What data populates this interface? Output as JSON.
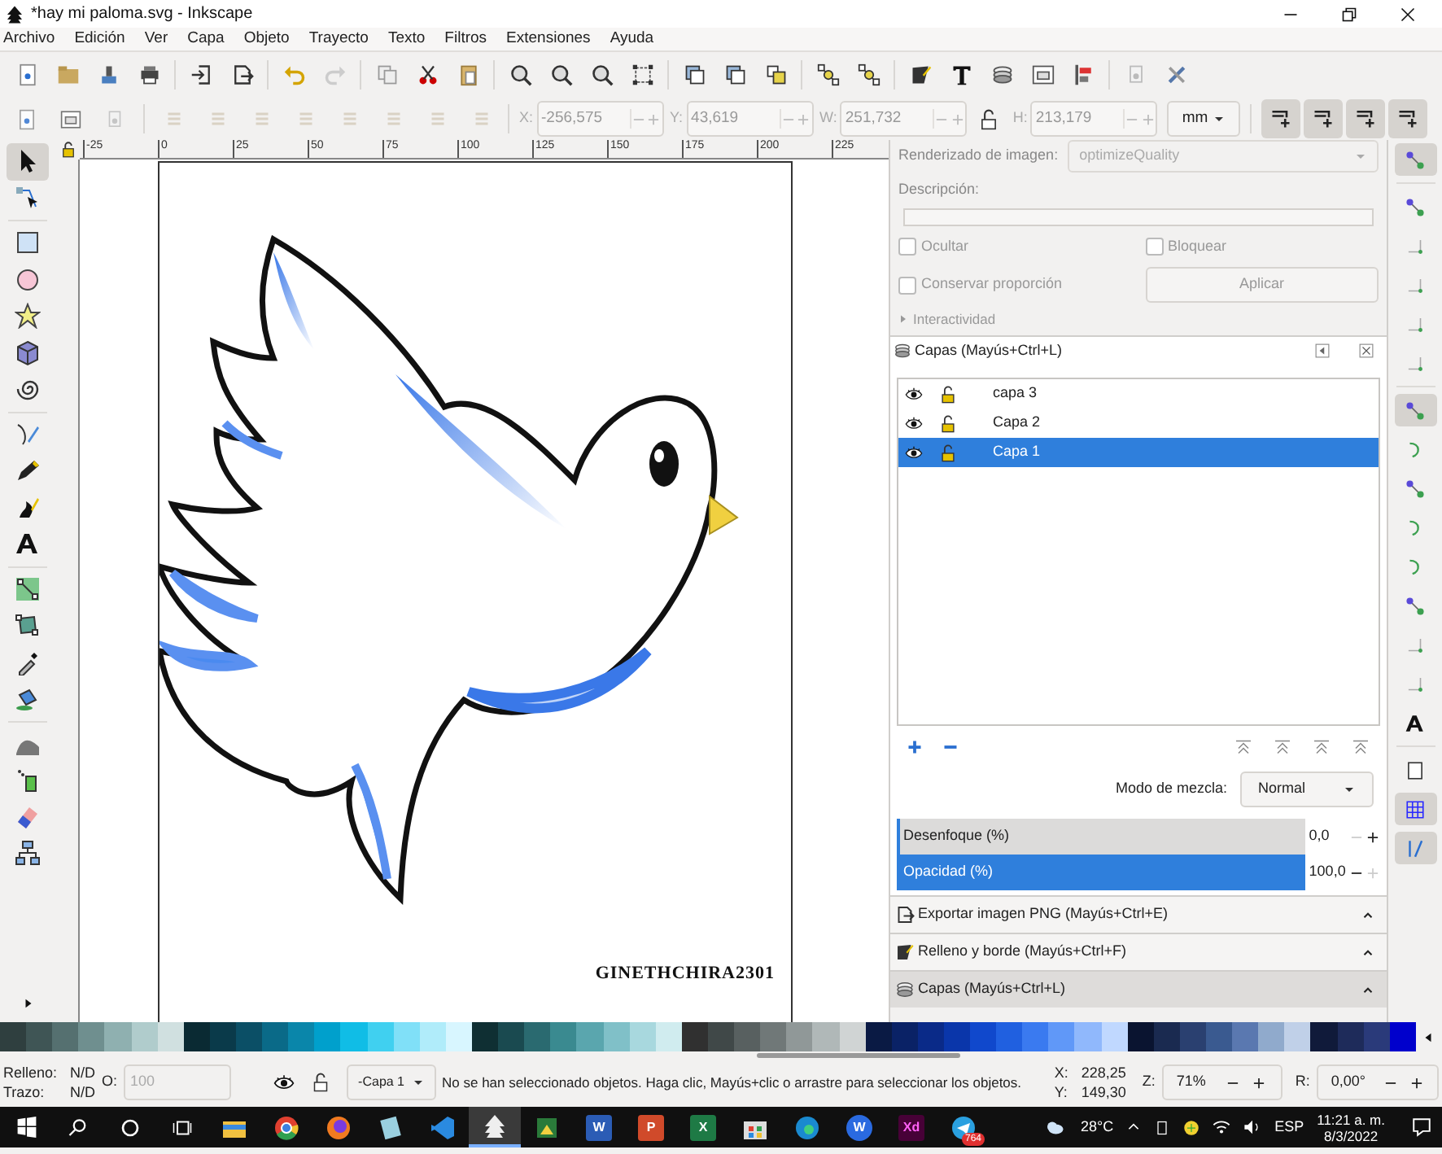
{
  "window": {
    "title": "*hay mi paloma.svg - Inkscape"
  },
  "menu": [
    "Archivo",
    "Edición",
    "Ver",
    "Capa",
    "Objeto",
    "Trayecto",
    "Texto",
    "Filtros",
    "Extensiones",
    "Ayuda"
  ],
  "geometry": [
    {
      "label": "X:",
      "value": "-256,575",
      "disabled": true
    },
    {
      "label": "Y:",
      "value": "43,619",
      "disabled": true
    },
    {
      "label": "W:",
      "value": "251,732",
      "disabled": true
    },
    {
      "label": "H:",
      "value": "213,179",
      "disabled": true
    }
  ],
  "unit": "mm",
  "ruler_labels": [
    "-25",
    "0",
    "25",
    "50",
    "75",
    "100",
    "125",
    "150",
    "175",
    "200",
    "225"
  ],
  "canvas": {
    "signature": "GINETHCHIRA2301"
  },
  "object_properties": {
    "rendering_label": "Renderizado de imagen:",
    "rendering_value": "optimizeQuality",
    "description_label": "Descripción:",
    "checkboxes": [
      {
        "label": "Ocultar",
        "checked": false
      },
      {
        "label": "Bloquear",
        "checked": false
      },
      {
        "label": "Conservar proporción",
        "checked": false
      }
    ],
    "apply_button": "Aplicar",
    "interactivity": {
      "label": "Interactividad",
      "expanded": false
    }
  },
  "layers_panel": {
    "title": "Capas (Mayús+Ctrl+L)",
    "layers": [
      {
        "name": "capa 3",
        "selected": false
      },
      {
        "name": "Capa 2",
        "selected": false
      },
      {
        "name": "Capa 1",
        "selected": true
      }
    ],
    "blend_label": "Modo de mezcla:",
    "blend_value": "Normal",
    "sliders": [
      {
        "label": "Desenfoque (%)",
        "value": "0,0",
        "level": 0
      },
      {
        "label": "Opacidad (%)",
        "value": "100,0",
        "level": 1
      }
    ]
  },
  "dock_sections": [
    {
      "kind": "export",
      "title": "Exportar imagen PNG (Mayús+Ctrl+E)",
      "selected": false
    },
    {
      "kind": "fill",
      "title": "Relleno y borde (Mayús+Ctrl+F)",
      "selected": false
    },
    {
      "kind": "layers",
      "title": "Capas (Mayús+Ctrl+L)",
      "selected": true
    }
  ],
  "palette": [
    {
      "color": "#2f3f3f"
    },
    {
      "color": "#3f5555"
    },
    {
      "color": "#557070"
    },
    {
      "color": "#6f8f8f"
    },
    {
      "color": "#8fb0b0"
    },
    {
      "color": "#b0cccc"
    },
    {
      "color": "#d0e0e0"
    },
    {
      "color": "#0a2a33"
    },
    {
      "color": "#0a3a4a"
    },
    {
      "color": "#0b4f66"
    },
    {
      "color": "#0a6a88"
    },
    {
      "color": "#0a86aa"
    },
    {
      "color": "#00a0cc"
    },
    {
      "color": "#10bde6"
    },
    {
      "color": "#40d0f0"
    },
    {
      "color": "#80e0f8"
    },
    {
      "color": "#b0ecfa"
    },
    {
      "color": "#d8f6ff"
    },
    {
      "color": "#0f2f33"
    },
    {
      "color": "#1a4a50"
    },
    {
      "color": "#2a6a70"
    },
    {
      "color": "#3a8a90"
    },
    {
      "color": "#5aa6ae"
    },
    {
      "color": "#80c0c8"
    },
    {
      "color": "#a8d8de"
    },
    {
      "color": "#d0ecef"
    },
    {
      "color": "#303030"
    },
    {
      "color": "#404848"
    },
    {
      "color": "#586060"
    },
    {
      "color": "#707878"
    },
    {
      "color": "#909898"
    },
    {
      "color": "#b0b8b8"
    },
    {
      "color": "#d0d4d4"
    },
    {
      "color": "#0a1a44"
    },
    {
      "color": "#0a2266"
    },
    {
      "color": "#0a2a88"
    },
    {
      "color": "#0a36aa"
    },
    {
      "color": "#1048cc"
    },
    {
      "color": "#2060e0"
    },
    {
      "color": "#3a7af0"
    },
    {
      "color": "#6098f8"
    },
    {
      "color": "#90b8fc"
    },
    {
      "color": "#c0d8ff"
    },
    {
      "color": "#0a1430"
    },
    {
      "color": "#1a2a50"
    },
    {
      "color": "#2a4070"
    },
    {
      "color": "#3a5a90"
    },
    {
      "color": "#5a78b0"
    },
    {
      "color": "#90aacc"
    },
    {
      "color": "#c0d0e8"
    },
    {
      "color": "#101a3a"
    },
    {
      "color": "#1e2b5a"
    },
    {
      "color": "#2a3a7a"
    },
    {
      "color": "#0000cc"
    }
  ],
  "status_bar": {
    "fill_label": "Relleno:",
    "fill_value": "N/D",
    "stroke_label": "Trazo:",
    "stroke_value": "N/D",
    "opacity_label": "O:",
    "opacity_value": "100",
    "layer": "-Capa 1",
    "message": "No se han seleccionado objetos. Haga clic, Mayús+clic o arrastre para seleccionar los objetos.",
    "x_label": "X:",
    "x_value": "228,25",
    "y_label": "Y:",
    "y_value": "149,30",
    "zoom_label": "Z:",
    "zoom_value": "71%",
    "rotation_label": "R:",
    "rotation_value": "0,00°"
  },
  "taskbar": {
    "apps": [
      {
        "kind": "explorer",
        "selected": false
      },
      {
        "kind": "chrome",
        "selected": false
      },
      {
        "kind": "firefox",
        "selected": false
      },
      {
        "kind": "notepad",
        "selected": false
      },
      {
        "kind": "vscode",
        "selected": false
      },
      {
        "kind": "inkscape",
        "selected": true
      },
      {
        "kind": "photo",
        "selected": false
      },
      {
        "kind": "word",
        "label": "W",
        "selected": false
      },
      {
        "kind": "powerpoint",
        "label": "P",
        "selected": false
      },
      {
        "kind": "excel",
        "label": "X",
        "selected": false
      },
      {
        "kind": "store",
        "selected": false
      },
      {
        "kind": "edge",
        "selected": false
      },
      {
        "kind": "app",
        "label": "W",
        "selected": false
      },
      {
        "kind": "xd",
        "label": "Xd",
        "selected": false
      },
      {
        "kind": "telegram",
        "badge": "764",
        "selected": false
      }
    ],
    "temperature": "28°C",
    "language": "ESP",
    "time": "11:21 a. m.",
    "date": "8/3/2022"
  }
}
